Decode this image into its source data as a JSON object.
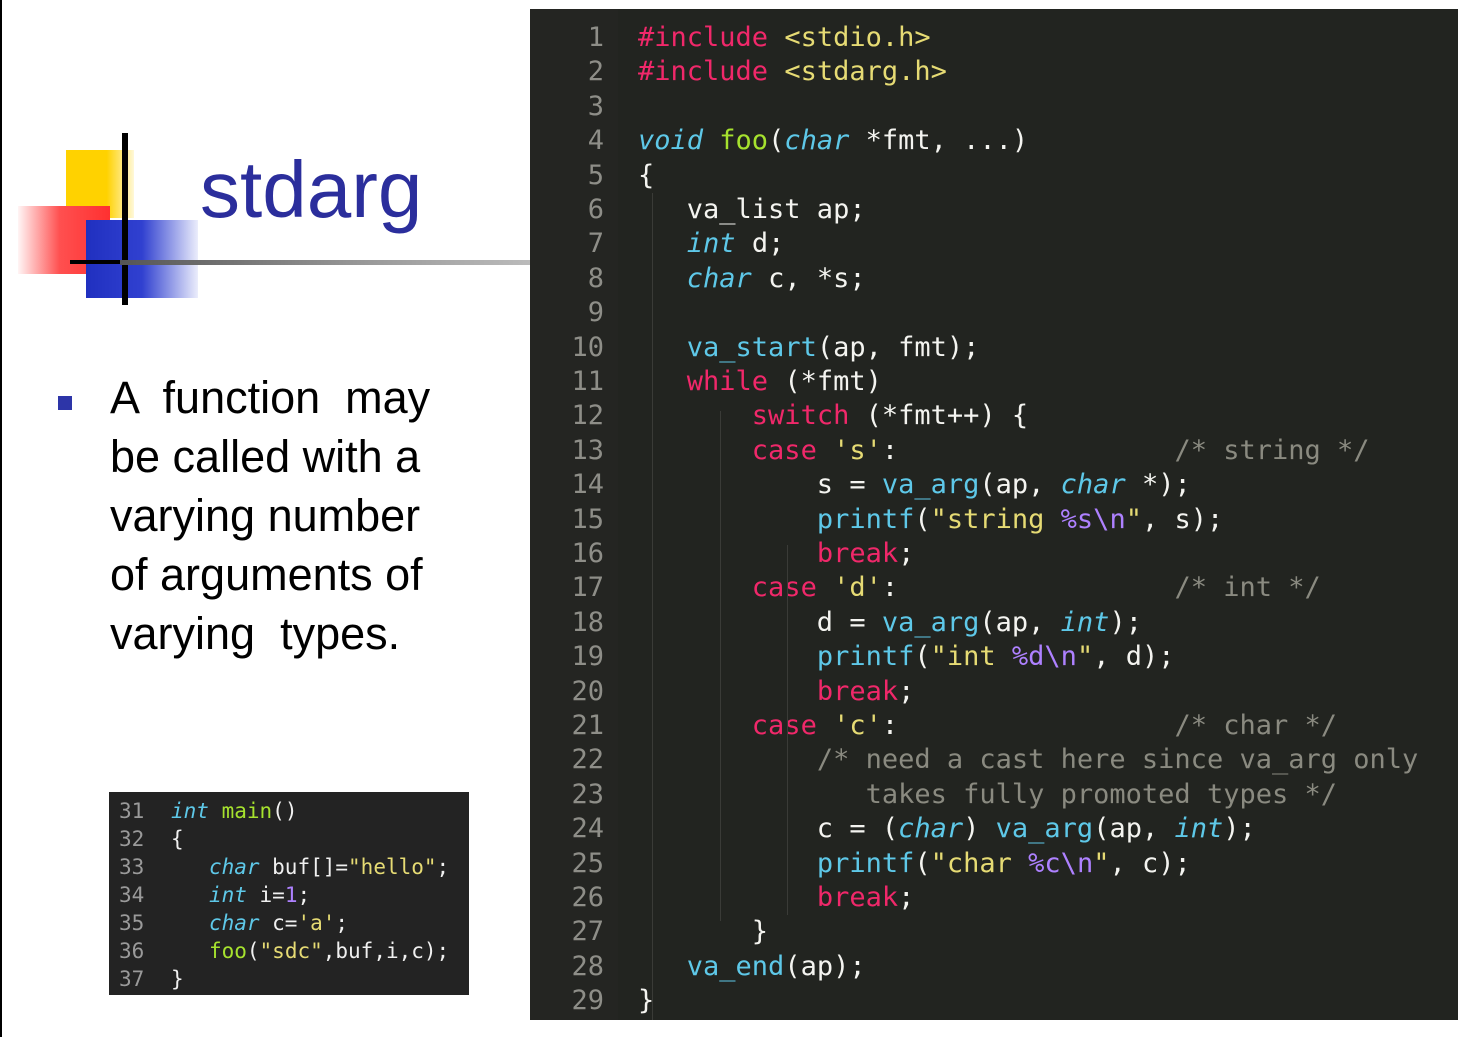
{
  "slide": {
    "title": "stdarg",
    "bullet_lines": [
      "A  function  may",
      "be called with a",
      "varying number",
      "of arguments of",
      "varying  types."
    ]
  },
  "small_code": {
    "lines": [
      {
        "n": "31",
        "tokens": [
          {
            "t": "int",
            "c": "kw-blue"
          },
          {
            "t": " "
          },
          {
            "t": "main",
            "c": "fn-green"
          },
          {
            "t": "()"
          }
        ]
      },
      {
        "n": "32",
        "tokens": [
          {
            "t": "{"
          }
        ]
      },
      {
        "n": "33",
        "tokens": [
          {
            "t": "   "
          },
          {
            "t": "char",
            "c": "kw-blue"
          },
          {
            "t": " buf[]="
          },
          {
            "t": "\"hello\"",
            "c": "str"
          },
          {
            "t": ";"
          }
        ]
      },
      {
        "n": "34",
        "tokens": [
          {
            "t": "   "
          },
          {
            "t": "int",
            "c": "kw-blue"
          },
          {
            "t": " i="
          },
          {
            "t": "1",
            "c": "num"
          },
          {
            "t": ";"
          }
        ]
      },
      {
        "n": "35",
        "tokens": [
          {
            "t": "   "
          },
          {
            "t": "char",
            "c": "kw-blue"
          },
          {
            "t": " c="
          },
          {
            "t": "'a'",
            "c": "str"
          },
          {
            "t": ";"
          }
        ]
      },
      {
        "n": "36",
        "tokens": [
          {
            "t": "   "
          },
          {
            "t": "foo",
            "c": "fn-green"
          },
          {
            "t": "("
          },
          {
            "t": "\"sdc\"",
            "c": "str"
          },
          {
            "t": ",buf,i,c);"
          }
        ]
      },
      {
        "n": "37",
        "tokens": [
          {
            "t": "}"
          }
        ]
      }
    ]
  },
  "big_code": {
    "lines": [
      {
        "n": "1",
        "tokens": [
          {
            "t": "#include",
            "c": "kw-red"
          },
          {
            "t": " "
          },
          {
            "t": "<stdio.h>",
            "c": "str"
          }
        ]
      },
      {
        "n": "2",
        "tokens": [
          {
            "t": "#include",
            "c": "kw-red"
          },
          {
            "t": " "
          },
          {
            "t": "<stdarg.h>",
            "c": "str"
          }
        ]
      },
      {
        "n": "3",
        "tokens": []
      },
      {
        "n": "4",
        "tokens": [
          {
            "t": "void",
            "c": "kw-blue"
          },
          {
            "t": " "
          },
          {
            "t": "foo",
            "c": "fn-green"
          },
          {
            "t": "("
          },
          {
            "t": "char",
            "c": "kw-blue"
          },
          {
            "t": " *fmt, ...)"
          }
        ]
      },
      {
        "n": "5",
        "tokens": [
          {
            "t": "{"
          }
        ]
      },
      {
        "n": "6",
        "tokens": [
          {
            "t": "   va_list ap;"
          }
        ]
      },
      {
        "n": "7",
        "tokens": [
          {
            "t": "   "
          },
          {
            "t": "int",
            "c": "kw-blue"
          },
          {
            "t": " d;"
          }
        ]
      },
      {
        "n": "8",
        "tokens": [
          {
            "t": "   "
          },
          {
            "t": "char",
            "c": "kw-blue"
          },
          {
            "t": " c, *s;"
          }
        ]
      },
      {
        "n": "9",
        "tokens": []
      },
      {
        "n": "10",
        "tokens": [
          {
            "t": "   "
          },
          {
            "t": "va_start",
            "c": "fn-blue"
          },
          {
            "t": "(ap, fmt);"
          }
        ]
      },
      {
        "n": "11",
        "tokens": [
          {
            "t": "   "
          },
          {
            "t": "while",
            "c": "kw-red"
          },
          {
            "t": " (*fmt)"
          }
        ]
      },
      {
        "n": "12",
        "tokens": [
          {
            "t": "       "
          },
          {
            "t": "switch",
            "c": "kw-red"
          },
          {
            "t": " (*fmt++) {"
          }
        ]
      },
      {
        "n": "13",
        "tokens": [
          {
            "t": "       "
          },
          {
            "t": "case",
            "c": "kw-red"
          },
          {
            "t": " "
          },
          {
            "t": "'s'",
            "c": "str"
          },
          {
            "t": ":"
          },
          {
            "t": "                 "
          },
          {
            "t": "/* string */",
            "c": "cmt"
          }
        ]
      },
      {
        "n": "14",
        "tokens": [
          {
            "t": "           s = "
          },
          {
            "t": "va_arg",
            "c": "fn-blue"
          },
          {
            "t": "(ap, "
          },
          {
            "t": "char",
            "c": "kw-blue"
          },
          {
            "t": " *);"
          }
        ]
      },
      {
        "n": "15",
        "tokens": [
          {
            "t": "           "
          },
          {
            "t": "printf",
            "c": "fn-blue"
          },
          {
            "t": "("
          },
          {
            "t": "\"string ",
            "c": "str"
          },
          {
            "t": "%s\\n",
            "c": "num"
          },
          {
            "t": "\"",
            "c": "str"
          },
          {
            "t": ", s);"
          }
        ]
      },
      {
        "n": "16",
        "tokens": [
          {
            "t": "           "
          },
          {
            "t": "break",
            "c": "kw-red"
          },
          {
            "t": ";"
          }
        ]
      },
      {
        "n": "17",
        "tokens": [
          {
            "t": "       "
          },
          {
            "t": "case",
            "c": "kw-red"
          },
          {
            "t": " "
          },
          {
            "t": "'d'",
            "c": "str"
          },
          {
            "t": ":"
          },
          {
            "t": "                 "
          },
          {
            "t": "/* int */",
            "c": "cmt"
          }
        ]
      },
      {
        "n": "18",
        "tokens": [
          {
            "t": "           d = "
          },
          {
            "t": "va_arg",
            "c": "fn-blue"
          },
          {
            "t": "(ap, "
          },
          {
            "t": "int",
            "c": "kw-blue"
          },
          {
            "t": ");"
          }
        ]
      },
      {
        "n": "19",
        "tokens": [
          {
            "t": "           "
          },
          {
            "t": "printf",
            "c": "fn-blue"
          },
          {
            "t": "("
          },
          {
            "t": "\"int ",
            "c": "str"
          },
          {
            "t": "%d\\n",
            "c": "num"
          },
          {
            "t": "\"",
            "c": "str"
          },
          {
            "t": ", d);"
          }
        ]
      },
      {
        "n": "20",
        "tokens": [
          {
            "t": "           "
          },
          {
            "t": "break",
            "c": "kw-red"
          },
          {
            "t": ";"
          }
        ]
      },
      {
        "n": "21",
        "tokens": [
          {
            "t": "       "
          },
          {
            "t": "case",
            "c": "kw-red"
          },
          {
            "t": " "
          },
          {
            "t": "'c'",
            "c": "str"
          },
          {
            "t": ":"
          },
          {
            "t": "                 "
          },
          {
            "t": "/* char */",
            "c": "cmt"
          }
        ]
      },
      {
        "n": "22",
        "tokens": [
          {
            "t": "           "
          },
          {
            "t": "/* need a cast here since va_arg only",
            "c": "cmt"
          }
        ]
      },
      {
        "n": "23",
        "tokens": [
          {
            "t": "              "
          },
          {
            "t": "takes fully promoted types */",
            "c": "cmt"
          }
        ]
      },
      {
        "n": "24",
        "tokens": [
          {
            "t": "           c = ("
          },
          {
            "t": "char",
            "c": "kw-blue"
          },
          {
            "t": ") "
          },
          {
            "t": "va_arg",
            "c": "fn-blue"
          },
          {
            "t": "(ap, "
          },
          {
            "t": "int",
            "c": "kw-blue"
          },
          {
            "t": ");"
          }
        ]
      },
      {
        "n": "25",
        "tokens": [
          {
            "t": "           "
          },
          {
            "t": "printf",
            "c": "fn-blue"
          },
          {
            "t": "("
          },
          {
            "t": "\"char ",
            "c": "str"
          },
          {
            "t": "%c\\n",
            "c": "num"
          },
          {
            "t": "\"",
            "c": "str"
          },
          {
            "t": ", c);"
          }
        ]
      },
      {
        "n": "26",
        "tokens": [
          {
            "t": "           "
          },
          {
            "t": "break",
            "c": "kw-red"
          },
          {
            "t": ";"
          }
        ]
      },
      {
        "n": "27",
        "tokens": [
          {
            "t": "       }"
          }
        ]
      },
      {
        "n": "28",
        "tokens": [
          {
            "t": "   "
          },
          {
            "t": "va_end",
            "c": "fn-blue"
          },
          {
            "t": "(ap);"
          }
        ]
      },
      {
        "n": "29",
        "tokens": [
          {
            "t": "}"
          }
        ]
      }
    ]
  },
  "colors": {
    "title": "#2b2e9c",
    "bullet": "#2d35a8",
    "code_bg": "#222420",
    "keyword_red": "#f0286a",
    "keyword_blue": "#5ec8e8",
    "function_green": "#a6e22e",
    "string": "#e6db74",
    "number": "#ae81ff",
    "comment": "#8a8a80"
  }
}
